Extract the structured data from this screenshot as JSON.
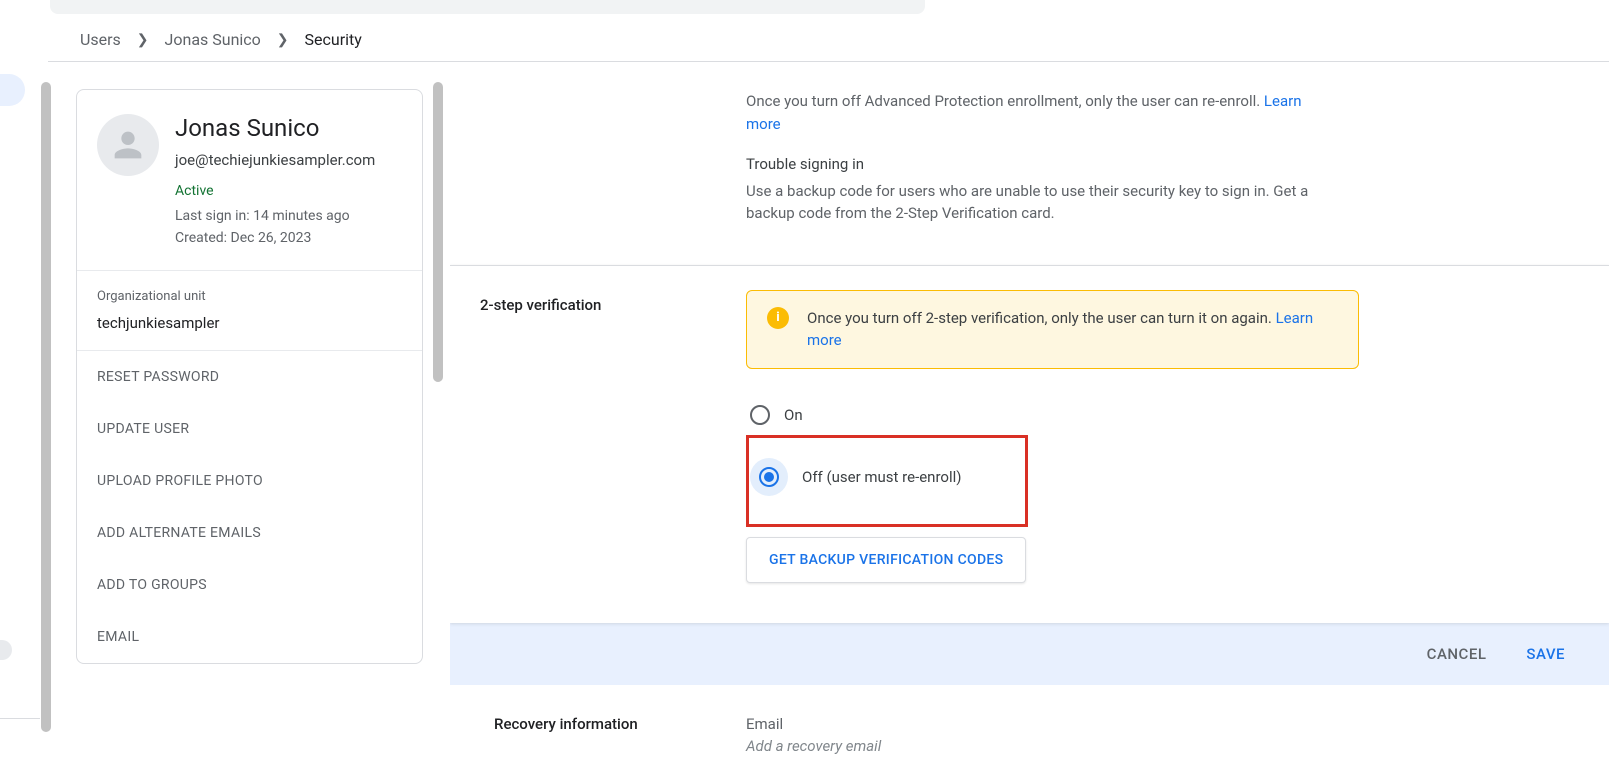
{
  "breadcrumb": {
    "items": [
      "Users",
      "Jonas Sunico",
      "Security"
    ]
  },
  "user": {
    "name": "Jonas Sunico",
    "email": "joe@techiejunkiesampler.com",
    "status": "Active",
    "last_sign_in": "Last sign in: 14 minutes ago",
    "created": "Created: Dec 26, 2023"
  },
  "org": {
    "label": "Organizational unit",
    "value": "techjunkiesampler"
  },
  "actions": [
    "RESET PASSWORD",
    "UPDATE USER",
    "UPLOAD PROFILE PHOTO",
    "ADD ALTERNATE EMAILS",
    "ADD TO GROUPS",
    "EMAIL"
  ],
  "advanced": {
    "text": "Once you turn off Advanced Protection enrollment, only the user can re-enroll. ",
    "learn_more": "Learn more",
    "trouble_title": "Trouble signing in",
    "trouble_body": "Use a backup code for users who are unable to use their security key to sign in. Get a backup code from the 2-Step Verification card."
  },
  "twostep": {
    "title": "2-step verification",
    "banner_text": "Once you turn off 2-step verification, only the user can turn it on again. ",
    "banner_link": "Learn more",
    "radio_on": "On",
    "radio_off": "Off (user must re-enroll)",
    "backup_button": "GET BACKUP VERIFICATION CODES"
  },
  "buttons": {
    "cancel": "CANCEL",
    "save": "SAVE"
  },
  "recovery": {
    "title": "Recovery information",
    "email_label": "Email",
    "email_placeholder": "Add a recovery email"
  }
}
